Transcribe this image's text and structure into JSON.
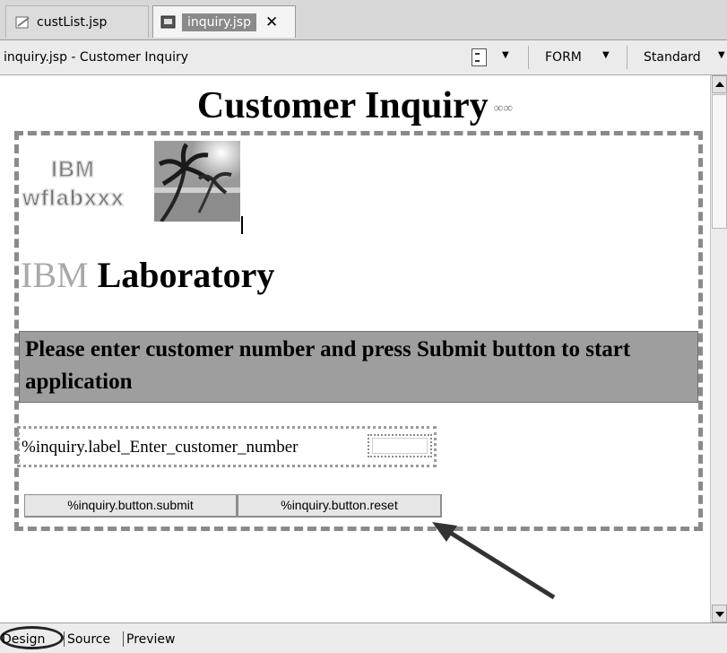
{
  "tabs": [
    {
      "label": "custList.jsp",
      "active": false,
      "icon": "jsp-file-icon"
    },
    {
      "label": "inquiry.jsp",
      "active": true,
      "icon": "jsp-file-icon",
      "closable": true
    }
  ],
  "toolbar": {
    "title": "inquiry.jsp - Customer Inquiry",
    "form_label": "FORM",
    "style_label": "Standard"
  },
  "page": {
    "heading": "Customer Inquiry",
    "logo": {
      "line1": "IBM",
      "line2": "wflabxxx"
    },
    "lab_heading_ibm": "IBM",
    "lab_heading_rest": " Laboratory",
    "instruction": "Please enter customer number and press Submit button to start application",
    "input_label": "%inquiry.label_Enter_customer_number",
    "input_value": "",
    "submit_label": "%inquiry.button.submit",
    "reset_label": "%inquiry.button.reset"
  },
  "bottom_tabs": [
    {
      "label": "Design",
      "active": true
    },
    {
      "label": "Source",
      "active": false
    },
    {
      "label": "Preview",
      "active": false
    }
  ],
  "colors": {
    "instruction_bg": "#9e9e9e",
    "ibm_gray": "#a9a9a9",
    "annotation_arrow": "#333333"
  }
}
